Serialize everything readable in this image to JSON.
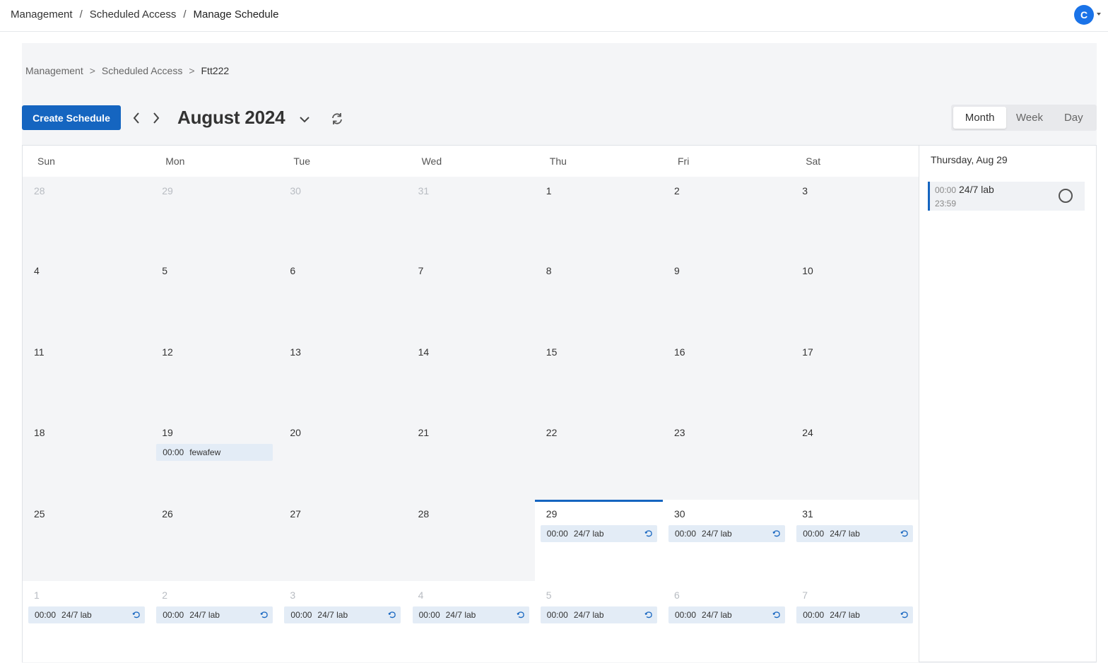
{
  "topbar": {
    "breadcrumb": [
      "Management",
      "Scheduled Access",
      "Manage Schedule"
    ],
    "separator": "/",
    "avatar_initial": "C"
  },
  "page_breadcrumb": {
    "items": [
      "Management",
      "Scheduled Access",
      "Ftt222"
    ],
    "separator": ">"
  },
  "toolbar": {
    "create_label": "Create Schedule",
    "month_title": "August 2024",
    "views": [
      {
        "label": "Month",
        "active": true
      },
      {
        "label": "Week",
        "active": false
      },
      {
        "label": "Day",
        "active": false
      }
    ]
  },
  "calendar": {
    "weekdays": [
      "Sun",
      "Mon",
      "Tue",
      "Wed",
      "Thu",
      "Fri",
      "Sat"
    ],
    "weeks": [
      [
        {
          "day": "28",
          "muted": true,
          "past": true,
          "events": []
        },
        {
          "day": "29",
          "muted": true,
          "past": true,
          "events": []
        },
        {
          "day": "30",
          "muted": true,
          "past": true,
          "events": []
        },
        {
          "day": "31",
          "muted": true,
          "past": true,
          "events": []
        },
        {
          "day": "1",
          "muted": false,
          "past": true,
          "events": []
        },
        {
          "day": "2",
          "muted": false,
          "past": true,
          "events": []
        },
        {
          "day": "3",
          "muted": false,
          "past": true,
          "events": []
        }
      ],
      [
        {
          "day": "4",
          "muted": false,
          "past": true,
          "events": []
        },
        {
          "day": "5",
          "muted": false,
          "past": true,
          "events": []
        },
        {
          "day": "6",
          "muted": false,
          "past": true,
          "events": []
        },
        {
          "day": "7",
          "muted": false,
          "past": true,
          "events": []
        },
        {
          "day": "8",
          "muted": false,
          "past": true,
          "events": []
        },
        {
          "day": "9",
          "muted": false,
          "past": true,
          "events": []
        },
        {
          "day": "10",
          "muted": false,
          "past": true,
          "events": []
        }
      ],
      [
        {
          "day": "11",
          "muted": false,
          "past": true,
          "events": []
        },
        {
          "day": "12",
          "muted": false,
          "past": true,
          "events": []
        },
        {
          "day": "13",
          "muted": false,
          "past": true,
          "events": []
        },
        {
          "day": "14",
          "muted": false,
          "past": true,
          "events": []
        },
        {
          "day": "15",
          "muted": false,
          "past": true,
          "events": []
        },
        {
          "day": "16",
          "muted": false,
          "past": true,
          "events": []
        },
        {
          "day": "17",
          "muted": false,
          "past": true,
          "events": []
        }
      ],
      [
        {
          "day": "18",
          "muted": false,
          "past": true,
          "events": []
        },
        {
          "day": "19",
          "muted": false,
          "past": true,
          "events": [
            {
              "time": "00:00",
              "title": "fewafew",
              "recurring": false
            }
          ]
        },
        {
          "day": "20",
          "muted": false,
          "past": true,
          "events": []
        },
        {
          "day": "21",
          "muted": false,
          "past": true,
          "events": []
        },
        {
          "day": "22",
          "muted": false,
          "past": true,
          "events": []
        },
        {
          "day": "23",
          "muted": false,
          "past": true,
          "events": []
        },
        {
          "day": "24",
          "muted": false,
          "past": true,
          "events": []
        }
      ],
      [
        {
          "day": "25",
          "muted": false,
          "past": true,
          "events": []
        },
        {
          "day": "26",
          "muted": false,
          "past": true,
          "events": []
        },
        {
          "day": "27",
          "muted": false,
          "past": true,
          "events": []
        },
        {
          "day": "28",
          "muted": false,
          "past": true,
          "events": []
        },
        {
          "day": "29",
          "muted": false,
          "past": false,
          "today": true,
          "events": [
            {
              "time": "00:00",
              "title": "24/7 lab",
              "recurring": true
            }
          ]
        },
        {
          "day": "30",
          "muted": false,
          "past": false,
          "events": [
            {
              "time": "00:00",
              "title": "24/7 lab",
              "recurring": true
            }
          ]
        },
        {
          "day": "31",
          "muted": false,
          "past": false,
          "events": [
            {
              "time": "00:00",
              "title": "24/7 lab",
              "recurring": true
            }
          ]
        }
      ],
      [
        {
          "day": "1",
          "muted": true,
          "past": false,
          "events": [
            {
              "time": "00:00",
              "title": "24/7 lab",
              "recurring": true
            }
          ]
        },
        {
          "day": "2",
          "muted": true,
          "past": false,
          "events": [
            {
              "time": "00:00",
              "title": "24/7 lab",
              "recurring": true
            }
          ]
        },
        {
          "day": "3",
          "muted": true,
          "past": false,
          "events": [
            {
              "time": "00:00",
              "title": "24/7 lab",
              "recurring": true
            }
          ]
        },
        {
          "day": "4",
          "muted": true,
          "past": false,
          "events": [
            {
              "time": "00:00",
              "title": "24/7 lab",
              "recurring": true
            }
          ]
        },
        {
          "day": "5",
          "muted": true,
          "past": false,
          "events": [
            {
              "time": "00:00",
              "title": "24/7 lab",
              "recurring": true
            }
          ]
        },
        {
          "day": "6",
          "muted": true,
          "past": false,
          "events": [
            {
              "time": "00:00",
              "title": "24/7 lab",
              "recurring": true
            }
          ]
        },
        {
          "day": "7",
          "muted": true,
          "past": false,
          "events": [
            {
              "time": "00:00",
              "title": "24/7 lab",
              "recurring": true
            }
          ]
        }
      ]
    ]
  },
  "sidebar": {
    "date_label": "Thursday, Aug 29",
    "event": {
      "start": "00:00",
      "end": "23:59",
      "title": "24/7 lab"
    }
  },
  "icons": {
    "prev": "chevron-left-icon",
    "next": "chevron-right-icon",
    "month_dropdown": "chevron-down-icon",
    "refresh": "refresh-icon",
    "recurring": "repeat-icon",
    "status": "circle-icon"
  },
  "colors": {
    "primary": "#1565c0",
    "avatar": "#1a73e8",
    "event_bg": "#e3ecf6",
    "past_bg": "#f4f5f7"
  }
}
